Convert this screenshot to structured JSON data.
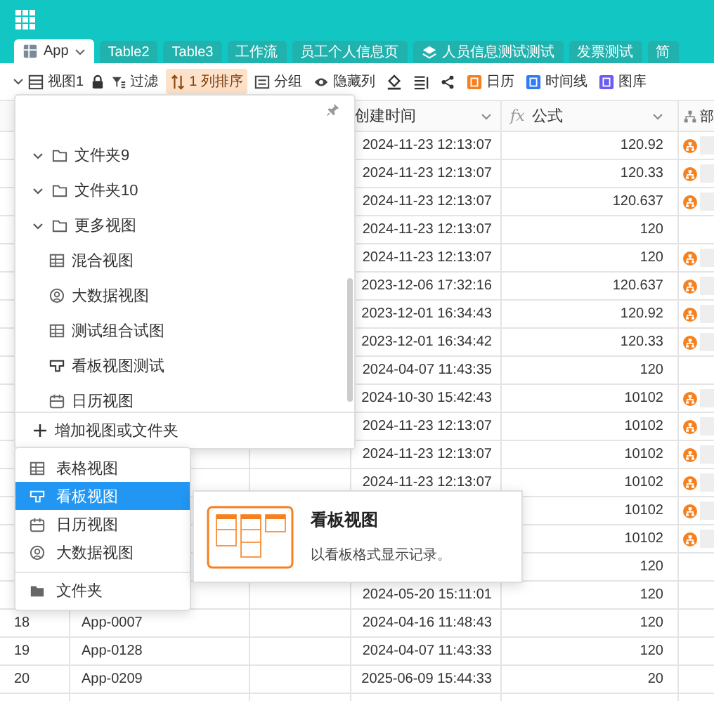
{
  "tabs": [
    {
      "label": "App",
      "kind": "table",
      "selected": true
    },
    {
      "label": "Table2",
      "kind": "plain",
      "selected": false
    },
    {
      "label": "Table3",
      "kind": "plain",
      "selected": false
    },
    {
      "label": "工作流",
      "kind": "plain",
      "selected": false
    },
    {
      "label": "员工个人信息页",
      "kind": "plain",
      "selected": false
    },
    {
      "label": "人员信息测试测试",
      "kind": "layers",
      "selected": false
    },
    {
      "label": "发票测试",
      "kind": "plain",
      "selected": false
    },
    {
      "label": "简",
      "kind": "plain",
      "selected": false
    }
  ],
  "toolbar": {
    "view_name": "视图1",
    "buttons": [
      {
        "kind": "filter",
        "label": "过滤",
        "active": false
      },
      {
        "kind": "sort",
        "label": "1 列排序",
        "active": true
      },
      {
        "kind": "group",
        "label": "分组",
        "active": false
      },
      {
        "kind": "hide",
        "label": "隐藏列",
        "active": false
      },
      {
        "kind": "fill",
        "active": false
      },
      {
        "kind": "row_height",
        "active": false
      },
      {
        "kind": "share",
        "active": false
      },
      {
        "kind": "calendar",
        "label": "日历",
        "active": false
      },
      {
        "kind": "timeline",
        "label": "时间线",
        "active": false
      },
      {
        "kind": "gallery",
        "label": "图库",
        "active": false
      }
    ]
  },
  "table": {
    "columns": [
      {
        "kind": "created",
        "label": "创建时间"
      },
      {
        "kind": "formula",
        "label": "公式",
        "prefix": "fx"
      },
      {
        "kind": "dept",
        "label": "部"
      }
    ],
    "rows": [
      {
        "created": "2024-11-23 12:13:07",
        "formula": "120.92",
        "dept_tag": true
      },
      {
        "created": "2024-11-23 12:13:07",
        "formula": "120.33",
        "dept_tag": true
      },
      {
        "created": "2024-11-23 12:13:07",
        "formula": "120.637",
        "dept_tag": true
      },
      {
        "created": "2024-11-23 12:13:07",
        "formula": "120"
      },
      {
        "created": "2024-11-23 12:13:07",
        "formula": "120",
        "dept_tag": true
      },
      {
        "created": "2023-12-06 17:32:16",
        "formula": "120.637",
        "dept_tag": true
      },
      {
        "created": "2023-12-01 16:34:43",
        "formula": "120.92",
        "dept_tag": true
      },
      {
        "created": "2023-12-01 16:34:42",
        "formula": "120.33",
        "dept_tag": true
      },
      {
        "created": "2024-04-07 11:43:35",
        "formula": "120"
      },
      {
        "created": "2024-10-30 15:42:43",
        "formula": "10102",
        "dept_tag": true
      },
      {
        "created": "2024-11-23 12:13:07",
        "formula": "10102",
        "dept_tag": true
      },
      {
        "created": "2024-11-23 12:13:07",
        "formula": "10102",
        "dept_tag": true
      },
      {
        "created": "2024-11-23 12:13:07",
        "formula": "10102",
        "dept_tag": true
      },
      {
        "formula": "10102",
        "dept_tag": true
      },
      {
        "formula": "10102",
        "dept_tag": true
      },
      {
        "formula": "120"
      },
      {
        "created": "2024-05-20 15:11:01",
        "formula": "120"
      },
      {
        "number": "18",
        "name": "App-0007",
        "created": "2024-04-16 11:48:43",
        "formula": "120"
      },
      {
        "number": "19",
        "name": "App-0128",
        "created": "2024-04-07 11:43:33",
        "formula": "120"
      },
      {
        "number": "20",
        "name": "App-0209",
        "created": "2025-06-09 15:44:33",
        "formula": "20"
      }
    ]
  },
  "view_menu": {
    "items": [
      {
        "kind": "folder",
        "label": "文件夹9",
        "expanded": true
      },
      {
        "kind": "folder",
        "label": "文件夹10",
        "expanded": true
      },
      {
        "kind": "folder",
        "label": "更多视图",
        "expanded": true
      },
      {
        "kind": "grid",
        "label": "混合视图"
      },
      {
        "kind": "bigdata",
        "label": "大数据视图"
      },
      {
        "kind": "grid",
        "label": "测试组合试图"
      },
      {
        "kind": "kanban",
        "label": "看板视图测试"
      },
      {
        "kind": "calendar",
        "label": "日历视图"
      }
    ],
    "add_label": "增加视图或文件夹"
  },
  "new_view_menu": {
    "items": [
      {
        "kind": "grid",
        "label": "表格视图",
        "selected": false
      },
      {
        "kind": "kanban",
        "label": "看板视图",
        "selected": true
      },
      {
        "kind": "calendar",
        "label": "日历视图",
        "selected": false
      },
      {
        "kind": "bigdata",
        "label": "大数据视图",
        "selected": false
      },
      {
        "kind": "folder",
        "label": "文件夹",
        "selected": false
      }
    ]
  },
  "tooltip": {
    "title": "看板视图",
    "description": "以看板格式显示记录。"
  }
}
